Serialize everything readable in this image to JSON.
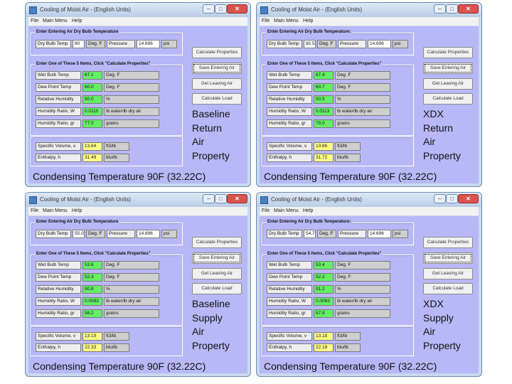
{
  "windows": [
    {
      "title": "Cooling of Moist Air - (English Units)",
      "menu": [
        "File",
        "Main Menu",
        "Help"
      ],
      "entering_legend": "Enter Entering Air Dry Bulb Temperature",
      "dry_bulb": {
        "label": "Dry Bulb Temp",
        "value": "80",
        "unit": "Deg. F",
        "pressure_label": "Pressure",
        "pressure_value": "14.696",
        "pressure_unit": "psi"
      },
      "five_legend": "Enter One of These 5 Items, Click \"Calculate Properties\"",
      "items": [
        {
          "label": "Wet Bulb Temp",
          "value": "67.1",
          "unit": "Deg. F"
        },
        {
          "label": "Dew Point Temp",
          "value": "60.0",
          "unit": "Deg. F"
        },
        {
          "label": "Relative Humidity",
          "value": "50.0",
          "unit": "%"
        },
        {
          "label": "Humidity Ratio, W",
          "value": "0.0110",
          "unit": "lb water/lb dry air"
        },
        {
          "label": "Humidity Ratio, gr",
          "value": "77.0",
          "unit": "grains"
        }
      ],
      "outputs": [
        {
          "label": "Specific Volume, v",
          "value": "13.84",
          "unit": "ft3/lb"
        },
        {
          "label": "Enthalpy, h",
          "value": "31.49",
          "unit": "btu/lb"
        }
      ],
      "buttons": [
        "Calculate Properties",
        "Save Entering Air",
        "Get Leaving Air",
        "Calculate Load"
      ],
      "annotation": [
        "Baseline",
        "Return",
        "Air",
        "Property"
      ],
      "condensing": "Condensing Temperature 90F (32.22C)"
    },
    {
      "title": "Cooling of Moist Air - (English Units)",
      "menu": [
        "File",
        "Main Menu",
        "Help"
      ],
      "entering_legend": "Enter Entering Air Dry Bulb Temperature:",
      "dry_bulb": {
        "label": "Dry Bulb Temp",
        "value": "80.5",
        "unit": "Deg. F",
        "pressure_label": "Pressure",
        "pressure_value": "14.696",
        "pressure_unit": "psi"
      },
      "five_legend": "Enter One of These 5 Items, Click \"Calculate Properties\"",
      "items": [
        {
          "label": "Wet Bulb Temp",
          "value": "67.4",
          "unit": "Deg. F"
        },
        {
          "label": "Dew Point Temp",
          "value": "60.7",
          "unit": "Deg. F"
        },
        {
          "label": "Relative Humidity",
          "value": "50.5",
          "unit": "%"
        },
        {
          "label": "Humidity Ratio, W",
          "value": "0.0113",
          "unit": "lb water/lb dry air"
        },
        {
          "label": "Humidity Ratio, gr",
          "value": "79.0",
          "unit": "grains"
        }
      ],
      "outputs": [
        {
          "label": "Specific Volume, v",
          "value": "13.86",
          "unit": "ft3/lb"
        },
        {
          "label": "Enthalpy, h",
          "value": "31.72",
          "unit": "btu/lb"
        }
      ],
      "buttons": [
        "Calculate Properties",
        "Save Entering Air",
        "Get Leaving Air",
        "Calculate Load"
      ],
      "annotation": [
        "XDX",
        "Return",
        "Air",
        "Property"
      ],
      "condensing": "Condensing Temperature 90F (32.22C)"
    },
    {
      "title": "Cooling of Moist Air - (English Units)",
      "menu": [
        "File",
        "Main Menu",
        "Help"
      ],
      "entering_legend": "Enter Entering Air Dry Bulb Temperature",
      "dry_bulb": {
        "label": "Dry Bulb Temp",
        "value": "55.0",
        "unit": "Deg. F",
        "pressure_label": "Pressure",
        "pressure_value": "14.696",
        "pressure_unit": "psi"
      },
      "five_legend": "Enter One of These 5 Items, Click \"Calculate Properties\"",
      "items": [
        {
          "label": "Wet Bulb Temp",
          "value": "53.6",
          "unit": "Deg. F"
        },
        {
          "label": "Dew Point Temp",
          "value": "52.3",
          "unit": "Deg. F"
        },
        {
          "label": "Relative Humidity",
          "value": "90.8",
          "unit": "%"
        },
        {
          "label": "Humidity Ratio, W",
          "value": "0.0083",
          "unit": "lb water/lb dry air"
        },
        {
          "label": "Humidity Ratio, gr",
          "value": "58.2",
          "unit": "grains"
        }
      ],
      "outputs": [
        {
          "label": "Specific Volume, v",
          "value": "13.19",
          "unit": "ft3/lb"
        },
        {
          "label": "Enthalpy, h",
          "value": "22.33",
          "unit": "btu/lb"
        }
      ],
      "buttons": [
        "Calculate Properties",
        "Save Entering Air",
        "Get Leaving Air",
        "Calculate Load"
      ],
      "annotation": [
        "Baseline",
        "Supply",
        "Air",
        "Property"
      ],
      "condensing": "Condensing Temperature 90F (32.22C)"
    },
    {
      "title": "Cooling of Moist Air - (English Units)",
      "menu": [
        "File",
        "Main Menu",
        "Help"
      ],
      "entering_legend": "Enter Entering Air Dry Bulb Temperature:",
      "dry_bulb": {
        "label": "Dry Bulb Temp",
        "value": "54.7",
        "unit": "Deg. F",
        "pressure_label": "Pressure",
        "pressure_value": "14.696",
        "pressure_unit": "psi"
      },
      "five_legend": "Enter One of These 5 Items, Click \"Calculate Properties\"",
      "items": [
        {
          "label": "Wet Bulb Temp",
          "value": "53.4",
          "unit": "Deg. F"
        },
        {
          "label": "Dew Point Temp",
          "value": "52.2",
          "unit": "Deg. F"
        },
        {
          "label": "Relative Humidity",
          "value": "91.2",
          "unit": "%"
        },
        {
          "label": "Humidity Ratio, W",
          "value": "0.0083",
          "unit": "lb water/lb dry air"
        },
        {
          "label": "Humidity Ratio, gr",
          "value": "57.9",
          "unit": "grains"
        }
      ],
      "outputs": [
        {
          "label": "Specific Volume, v",
          "value": "13.18",
          "unit": "ft3/lb"
        },
        {
          "label": "Enthalpy, h",
          "value": "22.18",
          "unit": "btu/lb"
        }
      ],
      "buttons": [
        "Calculate Properties",
        "Save Entering Air",
        "Get Leaving Air",
        "Calculate Load"
      ],
      "annotation": [
        "XDX",
        "Supply",
        "Air",
        "Property"
      ],
      "condensing": "Condensing Temperature 90F (32.22C)"
    }
  ]
}
